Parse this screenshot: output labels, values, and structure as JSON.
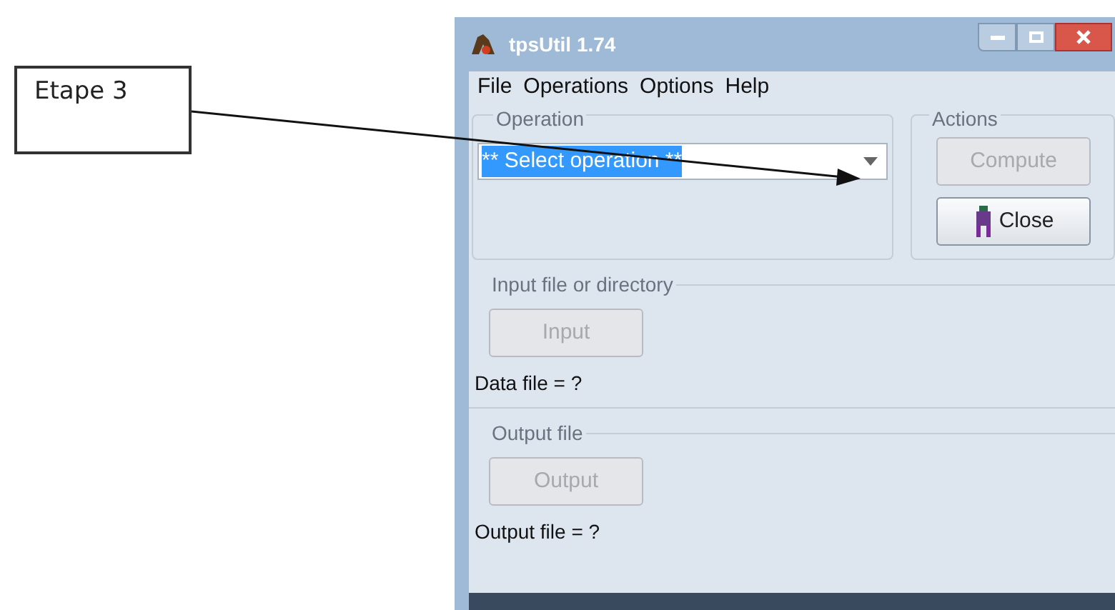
{
  "callout": {
    "text": "Etape 3"
  },
  "window": {
    "title": "tpsUtil 1.74"
  },
  "menu": [
    "File",
    "Operations",
    "Options",
    "Help"
  ],
  "operation_group": {
    "title": "Operation",
    "combo": {
      "value": "** Select operation **",
      "selected": true
    }
  },
  "actions_group": {
    "title": "Actions",
    "buttons": [
      {
        "label": "Compute",
        "disabled": true,
        "kind": "plain"
      },
      {
        "label": "Close",
        "disabled": false,
        "kind": "icon"
      }
    ]
  },
  "input_group": {
    "title": "Input file or directory",
    "button": {
      "label": "Input",
      "disabled": true
    },
    "status": "Data file = ?"
  },
  "output_group": {
    "title": "Output file",
    "button": {
      "label": "Output",
      "disabled": true
    },
    "status": "Output file = ?"
  }
}
